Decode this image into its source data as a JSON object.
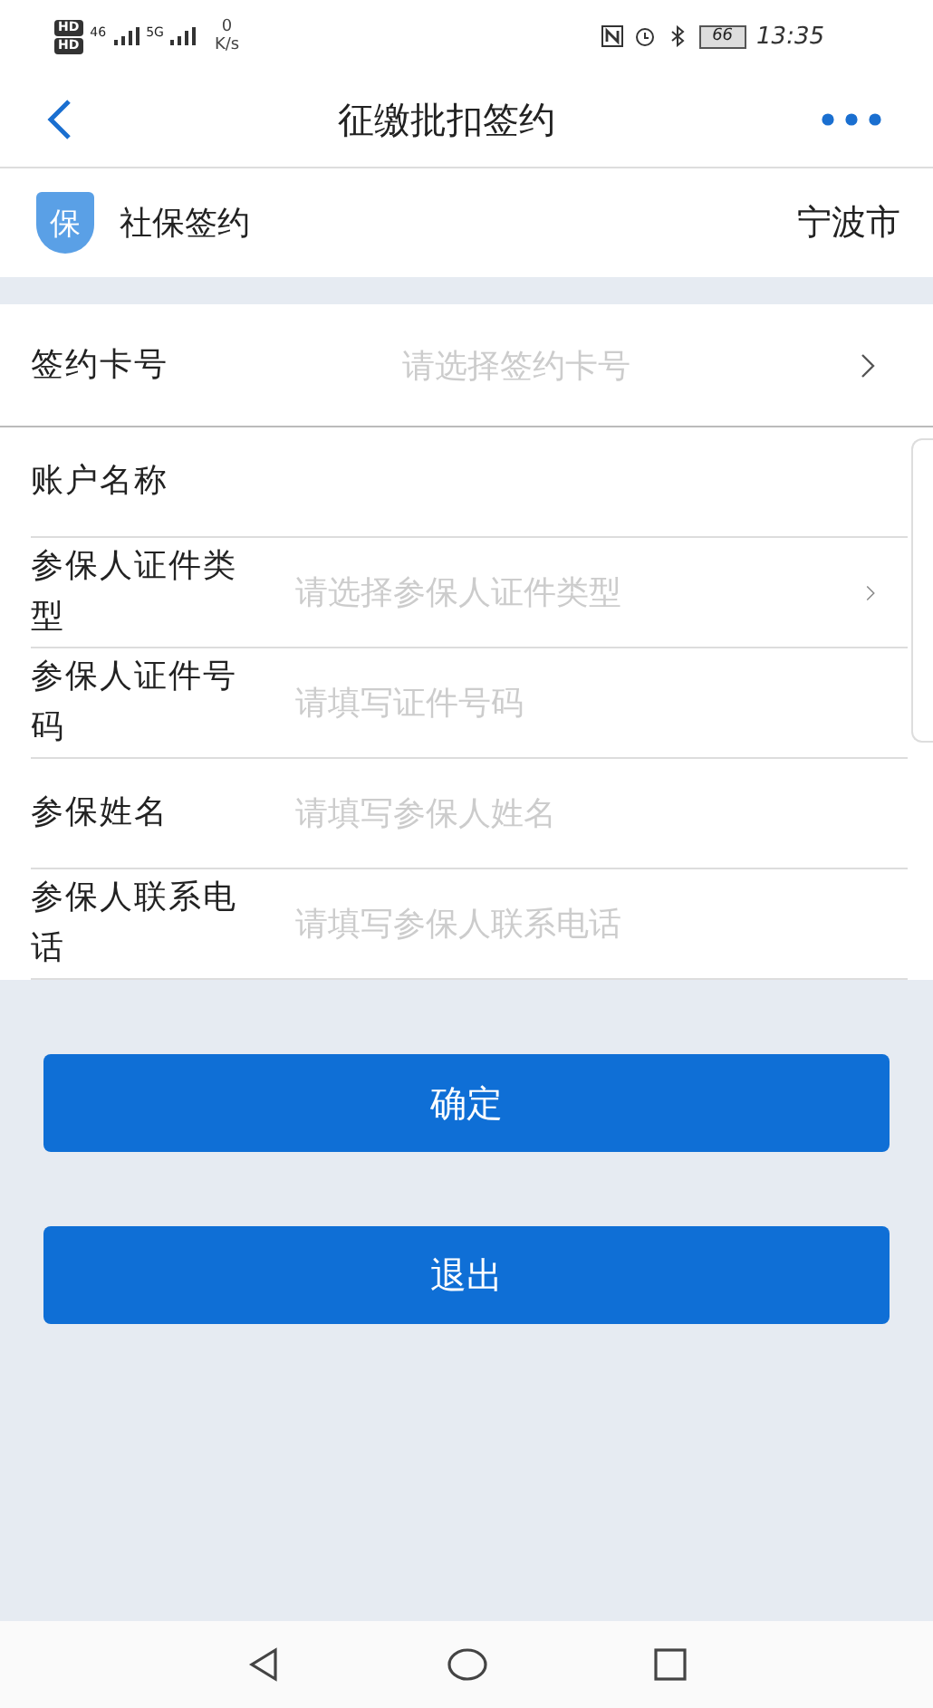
{
  "status_bar": {
    "sim_labels": [
      "HD",
      "HD"
    ],
    "signals": [
      "46",
      "5G"
    ],
    "speed": "0",
    "speed_unit": "K/s",
    "battery": "66",
    "time": "13:35"
  },
  "nav": {
    "title": "征缴批扣签约"
  },
  "header": {
    "title": "社保签约",
    "badge": "保",
    "city": "宁波市"
  },
  "rows": [
    {
      "kind": "select",
      "label": "签约卡号",
      "placeholder": "请选择签约卡号"
    },
    {
      "kind": "text",
      "label": "账户名称"
    },
    {
      "kind": "select",
      "label": "参保人证件类型",
      "placeholder": "请选择参保人证件类型"
    },
    {
      "kind": "input",
      "label": "参保人证件号码",
      "placeholder": "请填写证件号码"
    },
    {
      "kind": "input",
      "label": "参保姓名",
      "placeholder": "请填写参保人姓名"
    },
    {
      "kind": "input",
      "label": "参保人联系电话",
      "placeholder": "请填写参保人联系电话"
    }
  ],
  "buttons": [
    "确定",
    "退出"
  ]
}
